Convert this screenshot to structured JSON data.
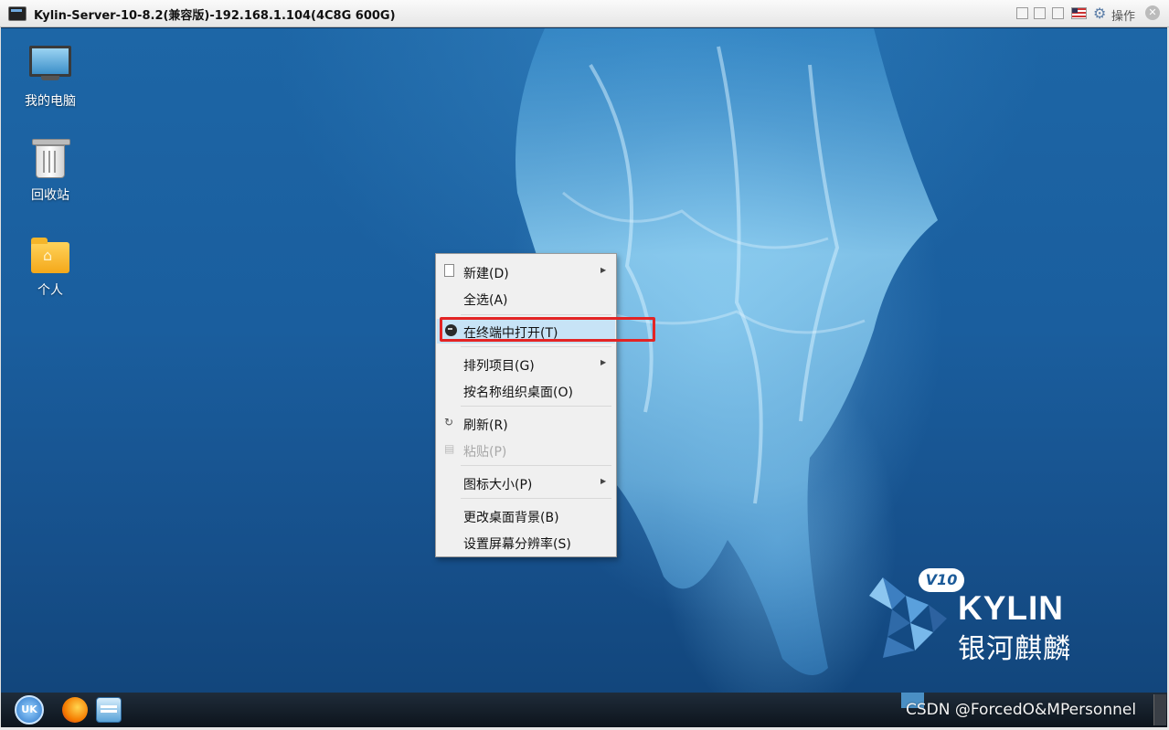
{
  "window": {
    "title": "Kylin-Server-10-8.2(兼容版)-192.168.1.104(4C8G 600G)",
    "actions_label": "操作"
  },
  "desktop_icons": [
    {
      "label": "我的电脑",
      "icon": "computer-icon"
    },
    {
      "label": "回收站",
      "icon": "trash-icon"
    },
    {
      "label": "个人",
      "icon": "home-folder-icon"
    }
  ],
  "context_menu": {
    "items": [
      {
        "label": "新建(D)",
        "icon": "new-document-icon",
        "submenu": true
      },
      {
        "label": "全选(A)"
      },
      {
        "label": "在终端中打开(T)",
        "icon": "terminal-icon",
        "highlighted": true
      },
      {
        "label": "排列项目(G)",
        "submenu": true
      },
      {
        "label": "按名称组织桌面(O)"
      },
      {
        "label": "刷新(R)",
        "icon": "refresh-icon"
      },
      {
        "label": "粘贴(P)",
        "icon": "paste-icon",
        "disabled": true
      },
      {
        "label": "图标大小(P)",
        "submenu": true
      },
      {
        "label": "更改桌面背景(B)"
      },
      {
        "label": "设置屏幕分辨率(S)"
      }
    ]
  },
  "branding": {
    "version_badge": "V10",
    "brand_en": "KYLIN",
    "brand_cn": "银河麒麟"
  },
  "taskbar": {
    "start_label": "UK",
    "apps": [
      "start-menu-icon",
      "firefox-icon",
      "file-manager-icon"
    ]
  },
  "watermark": "CSDN @ForcedO&MPersonnel",
  "colors": {
    "highlight_frame": "#e32424",
    "menu_highlight": "#c7e3f6",
    "desktop_blue": "#1a5e9e"
  }
}
